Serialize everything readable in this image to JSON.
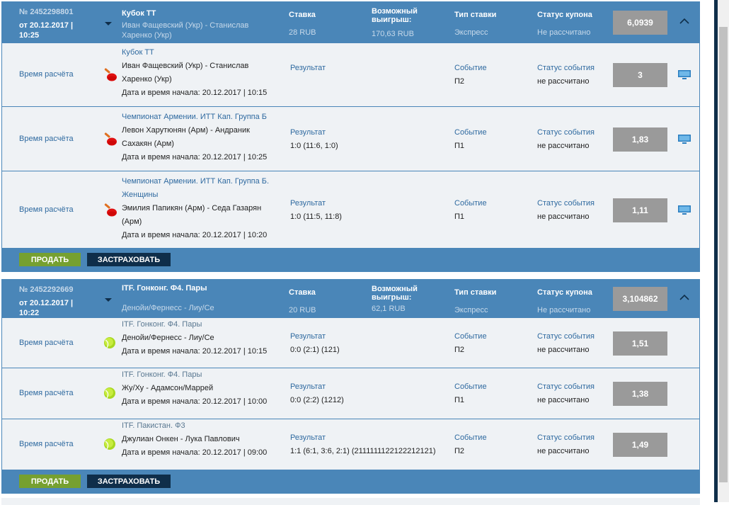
{
  "labels": {
    "stake": "Ставка",
    "win": "Возможный выигрыш:",
    "type": "Тип ставки",
    "coupon_status": "Статус купона",
    "calc_time": "Время расчёта",
    "result": "Результат",
    "event": "Событие",
    "event_status": "Статус события",
    "start": "Дата и время начала:",
    "sell": "ПРОДАТЬ",
    "insure": "ЗАСТРАХОВАТЬ"
  },
  "coupons": [
    {
      "number": "№ 2452298801",
      "date": "от 20.12.2017 | 10:25",
      "title": "Кубок ТТ",
      "match": "Иван Фащевский (Укр) - Станислав Харенко (Укр)",
      "stake": "28 RUB",
      "win": "170,63 RUB",
      "type": "Экспресс",
      "status": "Не рассчитано",
      "odds": "6,0939",
      "sport": "table-tennis",
      "events": [
        {
          "league": "Кубок ТТ",
          "match": "Иван Фащевский (Укр) - Станислав Харенко (Укр)",
          "start": "20.12.2017 | 10:15",
          "result": "",
          "pick": "П2",
          "status": "не рассчитано",
          "odds": "3"
        },
        {
          "league": "Чемпионат Армении. ИТТ Кап. Группа Б",
          "match": "Левон Харутюнян (Арм) - Андраник Сахакян (Арм)",
          "start": "20.12.2017 | 10:25",
          "result": "1:0 (11:6, 1:0)",
          "pick": "П1",
          "status": "не рассчитано",
          "odds": "1,83"
        },
        {
          "league": "Чемпионат Армении. ИТТ Кап. Группа Б. Женщины",
          "match": "Эмилия Папикян (Арм) - Седа Газарян (Арм)",
          "start": "20.12.2017 | 10:20",
          "result": "1:0 (11:5, 11:8)",
          "pick": "П1",
          "status": "не рассчитано",
          "odds": "1,11"
        }
      ]
    },
    {
      "number": "№ 2452292669",
      "date": "от 20.12.2017 | 10:22",
      "title": "ITF. Гонконг. Ф4. Пары",
      "match": "Денойи/Фернесс - Лиу/Се",
      "stake": "20 RUB",
      "win": "62,1 RUB",
      "type": "Экспресс",
      "status": "Не рассчитано",
      "odds": "3,104862",
      "sport": "tennis",
      "events": [
        {
          "league": "ITF. Гонконг. Ф4. Пары",
          "match": "Денойи/Фернесс - Лиу/Се",
          "start": "20.12.2017 | 10:15",
          "result": "0:0 (2:1) (121)",
          "pick": "П2",
          "status": "не рассчитано",
          "odds": "1,51"
        },
        {
          "league": "ITF. Гонконг. Ф4. Пары",
          "match": "Жу/Ху - Адамсон/Маррей",
          "start": "20.12.2017 | 10:00",
          "result": "0:0 (2:2) (1212)",
          "pick": "П1",
          "status": "не рассчитано",
          "odds": "1,38"
        },
        {
          "league": "ITF. Пакистан. Ф3",
          "match": "Джулиан Онкен - Лука Павлович",
          "start": "20.12.2017 | 09:00",
          "result": "1:1 (6:1, 3:6, 2:1) (2111111122122212121)",
          "pick": "П2",
          "status": "не рассчитано",
          "odds": "1,49"
        }
      ]
    }
  ]
}
